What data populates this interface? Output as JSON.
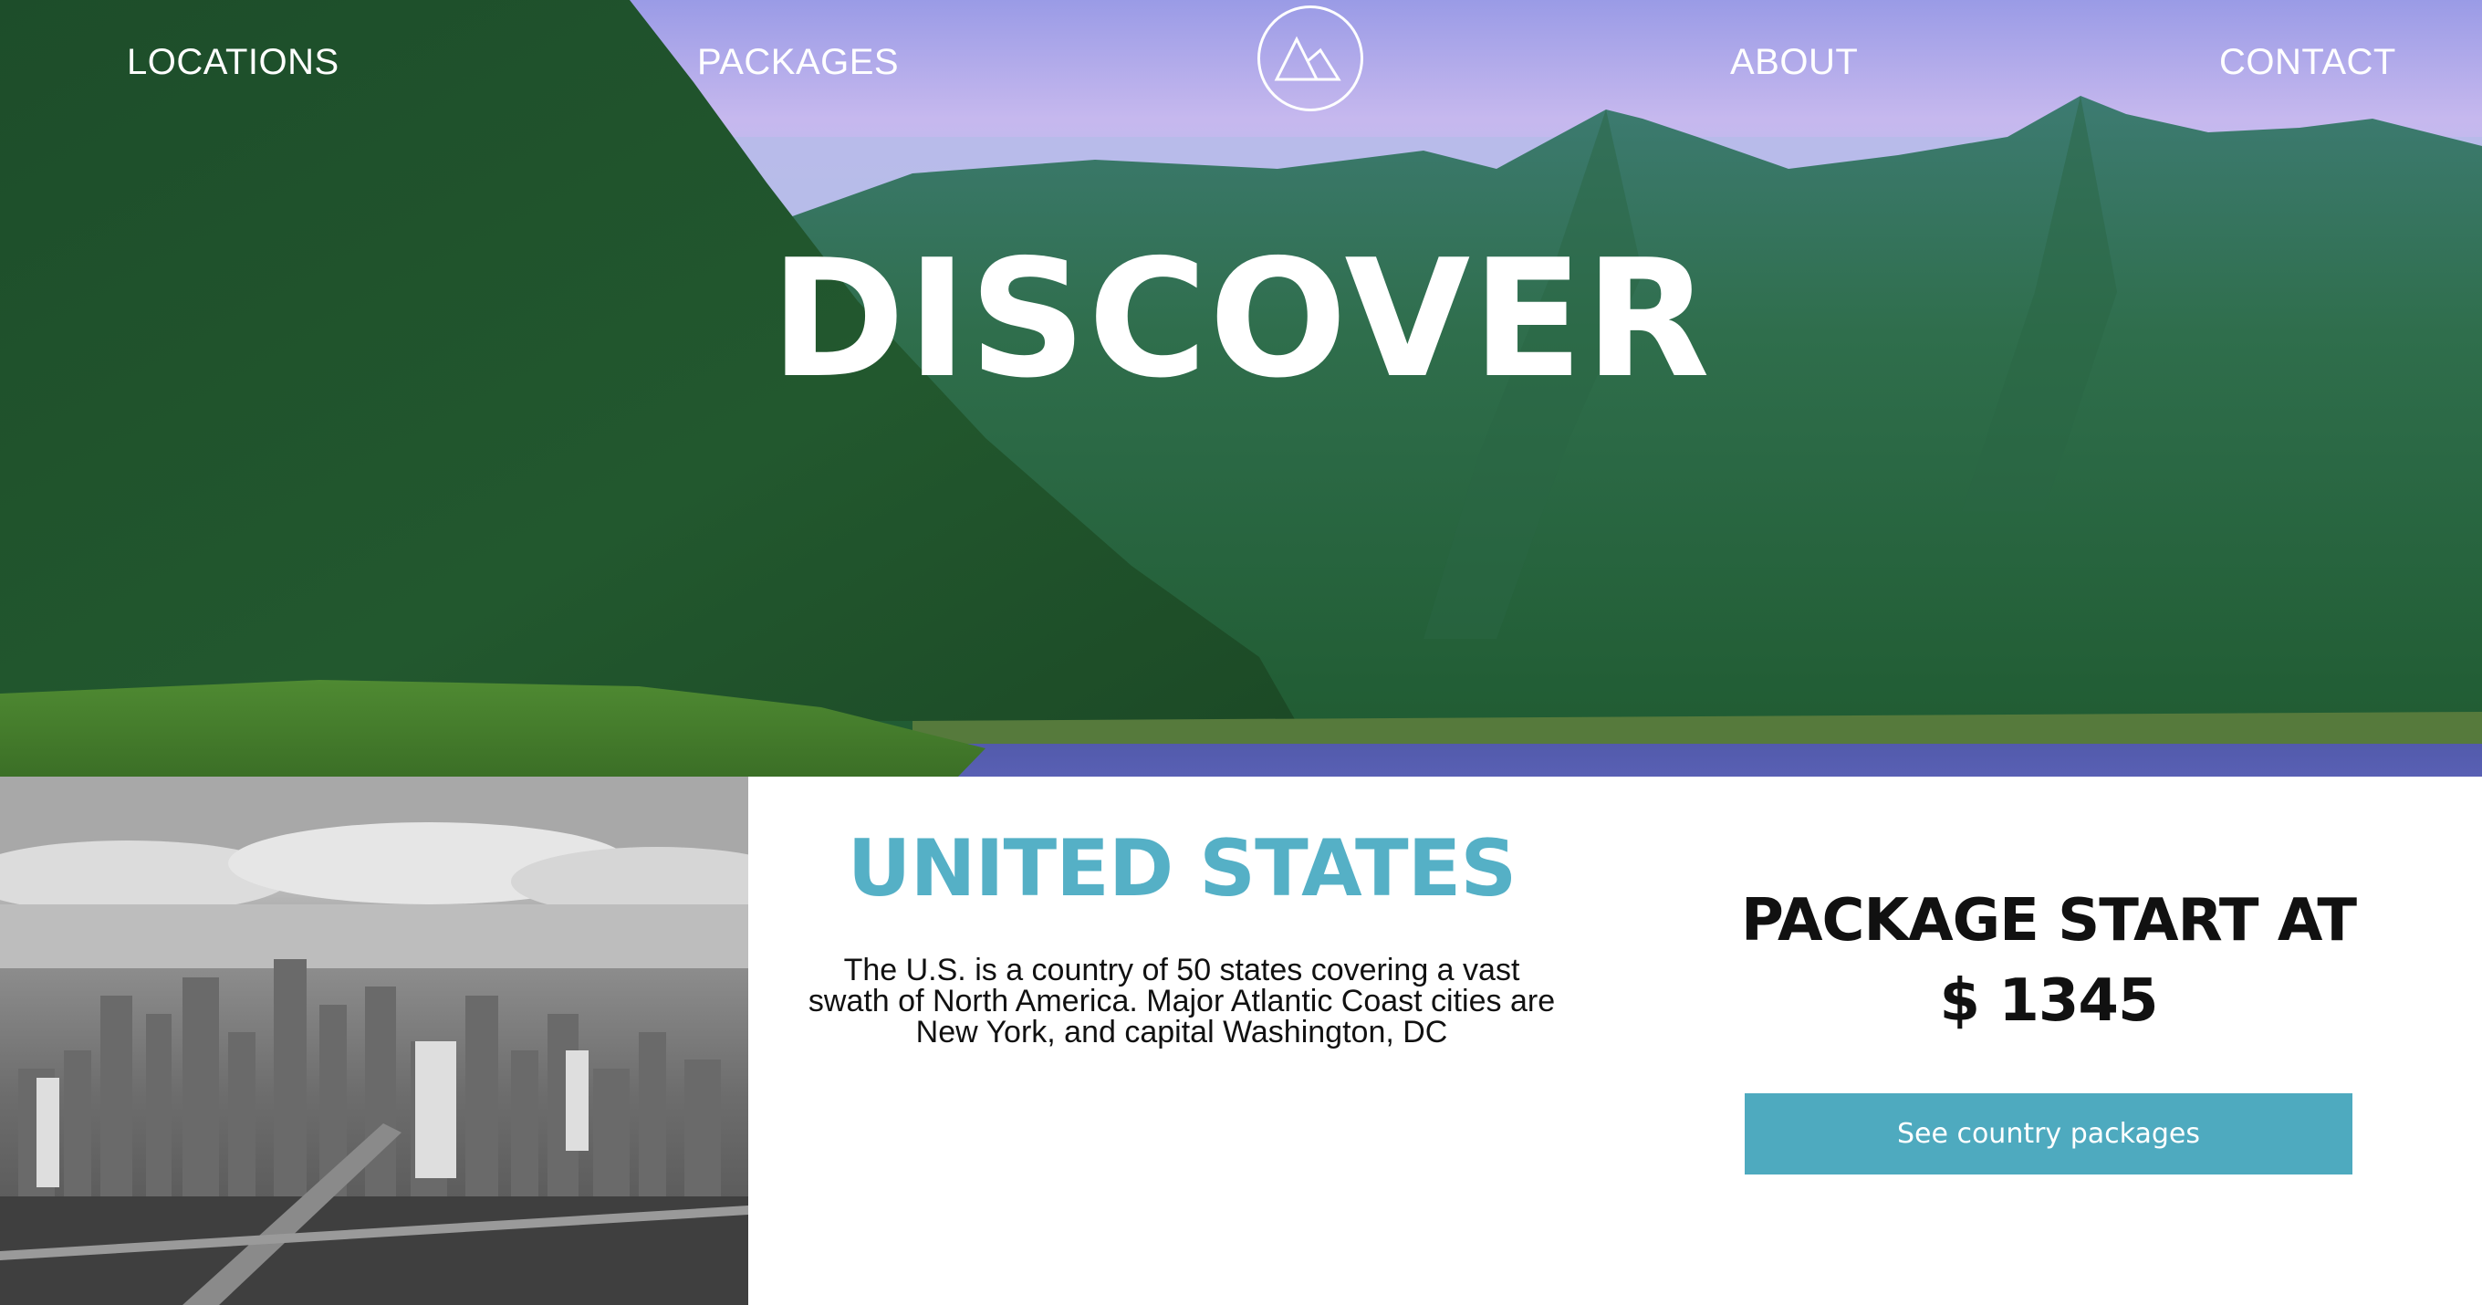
{
  "nav": {
    "locations": "LOCATIONS",
    "packages": "PACKAGES",
    "about": "ABOUT",
    "contact": "CONTACT"
  },
  "hero": {
    "title": "DISCOVER"
  },
  "country": {
    "name": "UNITED STATES",
    "description_lines": [
      "The U.S. is a country of 50 states covering a vast",
      "swath of North America. Major Atlantic Coast cities are",
      "New York, and capital Washington, DC"
    ]
  },
  "pricing": {
    "heading": "PACKAGE START AT",
    "price": "$ 1345"
  },
  "cta": {
    "label": "See country packages"
  },
  "colors": {
    "accent": "#55b0c6",
    "button": "#4eaabf",
    "text": "#111111"
  }
}
